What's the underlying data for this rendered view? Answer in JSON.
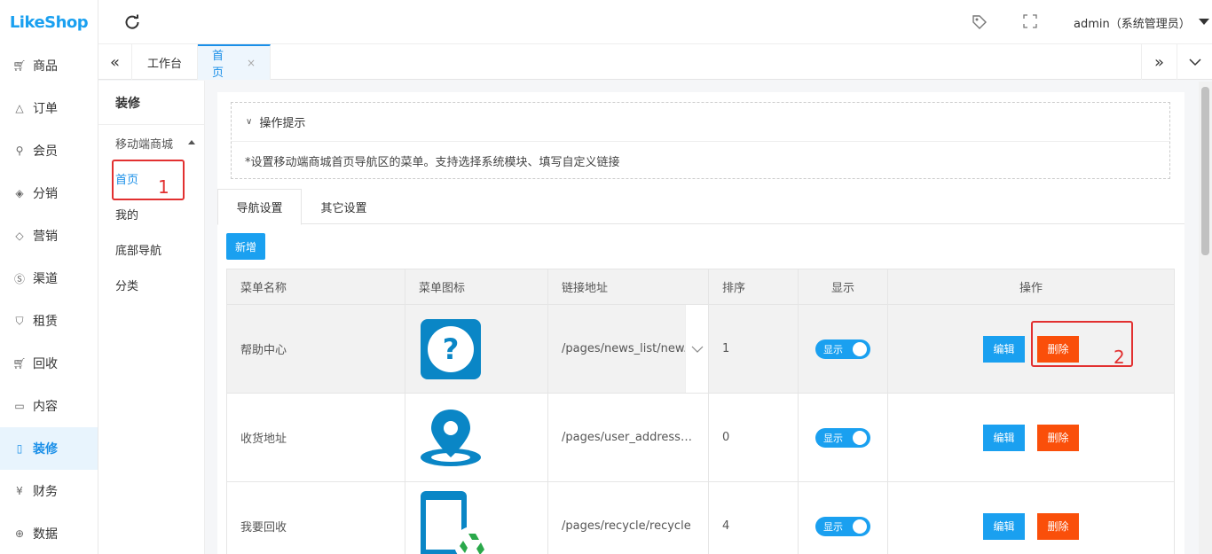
{
  "logo": "LikeShop",
  "sidebar": {
    "items": [
      {
        "label": "商品",
        "icon": "cart-icon"
      },
      {
        "label": "订单",
        "icon": "bell-icon"
      },
      {
        "label": "会员",
        "icon": "user-icon"
      },
      {
        "label": "分销",
        "icon": "layers-icon"
      },
      {
        "label": "营销",
        "icon": "diamond-icon"
      },
      {
        "label": "渠道",
        "icon": "coin-icon"
      },
      {
        "label": "租赁",
        "icon": "shield-icon"
      },
      {
        "label": "回收",
        "icon": "cart-icon"
      },
      {
        "label": "内容",
        "icon": "book-icon"
      },
      {
        "label": "装修",
        "icon": "phone-icon",
        "active": true
      },
      {
        "label": "财务",
        "icon": "yen-icon"
      },
      {
        "label": "数据",
        "icon": "globe-icon"
      }
    ]
  },
  "header": {
    "user": "admin（系统管理员）"
  },
  "tabbar": {
    "tabs": [
      {
        "label": "工作台"
      },
      {
        "label": "首页",
        "close": "×"
      }
    ]
  },
  "submenu": {
    "title": "装修",
    "group": "移动端商城",
    "items": [
      "首页",
      "我的",
      "底部导航",
      "分类"
    ]
  },
  "hint": {
    "title": "操作提示",
    "text": "*设置移动端商城首页导航区的菜单。支持选择系统模块、填写自定义链接"
  },
  "content_tabs": [
    "导航设置",
    "其它设置"
  ],
  "add_button": "新增",
  "table": {
    "headers": [
      "菜单名称",
      "菜单图标",
      "链接地址",
      "排序",
      "显示",
      "操作"
    ],
    "rows": [
      {
        "name": "帮助中心",
        "link": "/pages/news_list/new...",
        "sort": "1",
        "show": "显示",
        "edit": "编辑",
        "delete": "删除"
      },
      {
        "name": "收货地址",
        "link": "/pages/user_address/...",
        "sort": "0",
        "show": "显示",
        "edit": "编辑",
        "delete": "删除"
      },
      {
        "name": "我要回收",
        "link": "/pages/recycle/recycle",
        "sort": "4",
        "show": "显示",
        "edit": "编辑",
        "delete": "删除"
      }
    ]
  },
  "annotations": [
    "1",
    "2"
  ],
  "colors": {
    "primary": "#1aa0f0",
    "danger": "#fa4f0a",
    "annotation": "#e23030"
  }
}
